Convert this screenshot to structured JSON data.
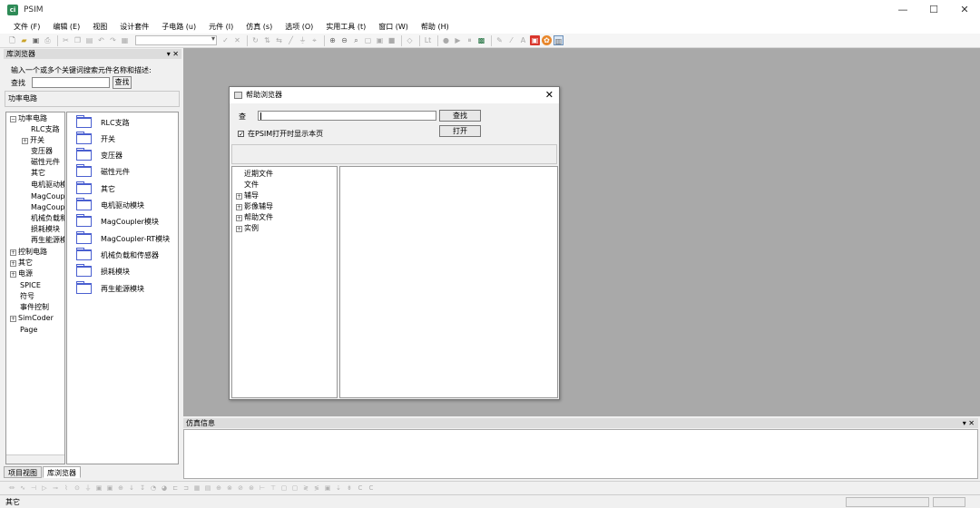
{
  "window": {
    "title": "PSIM",
    "icon_text": "ci",
    "controls": [
      "—",
      "☐",
      "✕"
    ]
  },
  "menubar": {
    "items": [
      "文件 (F)",
      "编辑 (E)",
      "视图",
      "设计套件",
      "子电路 (u)",
      "元件 (I)",
      "仿真 (s)",
      "选项 (O)",
      "实用工具 (t)",
      "窗口 (W)",
      "帮助 (H)"
    ]
  },
  "toolbar": {
    "icons": [
      "new-file",
      "open-folder",
      "save",
      "print",
      "cut",
      "copy",
      "paste",
      "undo",
      "redo",
      "image",
      "element-combo",
      "check",
      "close",
      "rotate",
      "flip",
      "mirror",
      "wire",
      "ground",
      "label",
      "zoom-in",
      "zoom-out",
      "zoom-fit",
      "zoom-box",
      "zoom-window",
      "stop",
      "probe",
      "text-lt",
      "run-circle",
      "play",
      "pause",
      "simview",
      "pencil",
      "slash",
      "text-a",
      "red-tool",
      "orange-tool",
      "lib-toggle"
    ]
  },
  "library_browser": {
    "header": "库浏览器",
    "header_controls": "▾ ✕",
    "description": "输入一个或多个关键词搜索元件名称和描述:",
    "search_label": "查找",
    "search_value": "",
    "search_button": "查找",
    "current_path": "功率电路",
    "tree": [
      {
        "label": "功率电路",
        "expander": "⊟",
        "level": 0
      },
      {
        "label": "RLC支路",
        "expander": "",
        "level": 1
      },
      {
        "label": "开关",
        "expander": "⊞",
        "level": 1
      },
      {
        "label": "变压器",
        "expander": "",
        "level": 1
      },
      {
        "label": "磁性元件",
        "expander": "",
        "level": 1
      },
      {
        "label": "其它",
        "expander": "",
        "level": 1
      },
      {
        "label": "电机驱动模",
        "expander": "",
        "level": 1
      },
      {
        "label": "MagCoupl",
        "expander": "",
        "level": 1
      },
      {
        "label": "MagCoupl",
        "expander": "",
        "level": 1
      },
      {
        "label": "机械负载和",
        "expander": "",
        "level": 1
      },
      {
        "label": "损耗模块",
        "expander": "",
        "level": 1
      },
      {
        "label": "再生能源模",
        "expander": "",
        "level": 1
      },
      {
        "label": "控制电路",
        "expander": "⊞",
        "level": 0
      },
      {
        "label": "其它",
        "expander": "⊞",
        "level": 0
      },
      {
        "label": "电源",
        "expander": "⊞",
        "level": 0
      },
      {
        "label": "SPICE",
        "expander": "",
        "level": 0
      },
      {
        "label": "符号",
        "expander": "",
        "level": 0
      },
      {
        "label": "事件控制",
        "expander": "",
        "level": 0
      },
      {
        "label": "SimCoder",
        "expander": "⊞",
        "level": 0
      },
      {
        "label": "Page",
        "expander": "",
        "level": 0
      }
    ],
    "folders": [
      "RLC支路",
      "开关",
      "变压器",
      "磁性元件",
      "其它",
      "电机驱动模块",
      "MagCoupler模块",
      "MagCoupler-RT模块",
      "机械负载和传感器",
      "损耗模块",
      "再生能源模块"
    ],
    "tabs": [
      {
        "label": "项目视图",
        "active": false
      },
      {
        "label": "库浏览器",
        "active": true
      }
    ]
  },
  "help_dialog": {
    "title": "帮助浏览器",
    "close": "✕",
    "search_label": "查",
    "search_value": "",
    "search_button": "查找",
    "checkbox_label": "在PSIM打开时显示本页",
    "checkbox_checked": true,
    "check_mark": "✓",
    "open_button": "打开",
    "tree": [
      {
        "label": "近期文件",
        "expander": ""
      },
      {
        "label": "文件",
        "expander": ""
      },
      {
        "label": "辅导",
        "expander": "⊞"
      },
      {
        "label": "影像辅导",
        "expander": "⊞"
      },
      {
        "label": "帮助文件",
        "expander": "⊞"
      },
      {
        "label": "实例",
        "expander": "⊞"
      }
    ]
  },
  "sim_info": {
    "header": "仿真信息",
    "header_controls": "▾ ✕"
  },
  "statusbar": {
    "text": "其它"
  }
}
